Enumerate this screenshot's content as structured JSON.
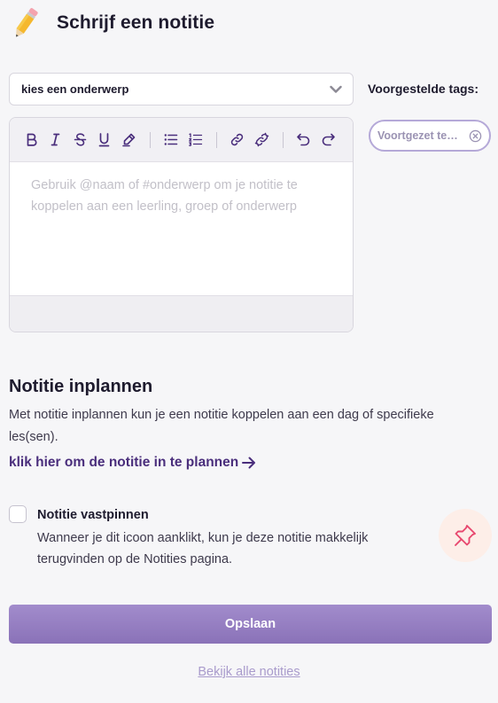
{
  "header": {
    "title": "Schrijf een notitie",
    "icon": "pencil-icon"
  },
  "subject_select": {
    "value": "kies een onderwerp",
    "icon": "chevron-down-icon"
  },
  "tags": {
    "label": "Voorgestelde tags:",
    "items": [
      {
        "label": "Voortgezet te…",
        "icon": "close-circle-icon"
      }
    ]
  },
  "editor": {
    "toolbar": [
      "bold",
      "italic",
      "strikethrough",
      "underline",
      "highlight",
      "bullet-list",
      "numbered-list",
      "link",
      "unlink",
      "undo",
      "redo"
    ],
    "placeholder": "Gebruik @naam of #onderwerp om je notitie te koppelen aan een leerling, groep of onderwerp"
  },
  "schedule": {
    "title": "Notitie inplannen",
    "description": "Met notitie inplannen kun je een notitie koppelen aan een dag of specifieke les(sen).",
    "link_label": "klik hier om de notitie in te plannen"
  },
  "pin": {
    "title": "Notitie vastpinnen",
    "description": "Wanneer je dit icoon aanklikt, kun je deze notitie makkelijk terugvinden op de Notities pagina.",
    "checked": false,
    "icon": "pushpin-icon"
  },
  "actions": {
    "save_label": "Opslaan",
    "view_all_label": "Bekijk alle notities"
  },
  "colors": {
    "accent": "#8a72b8",
    "link": "#4a2e7c",
    "pin": "#e8486f"
  }
}
